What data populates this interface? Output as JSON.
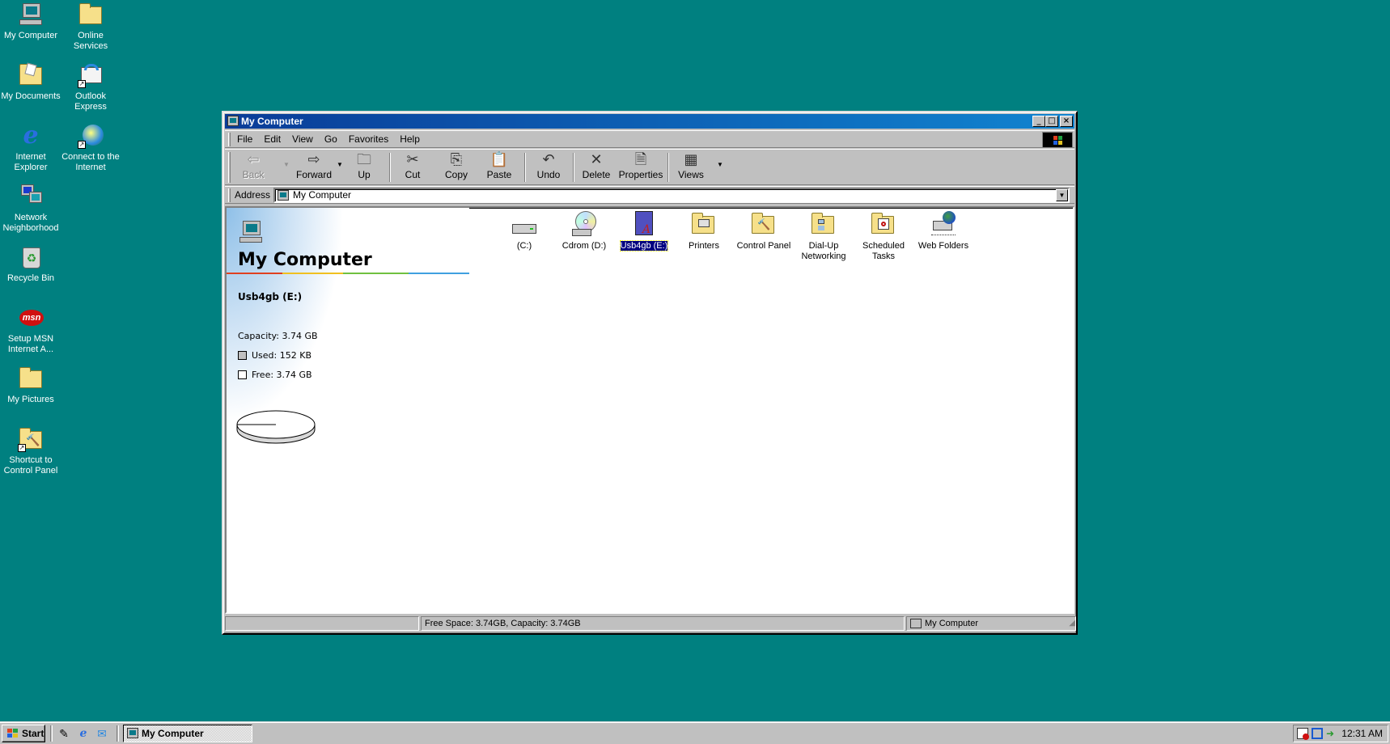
{
  "desktop": {
    "icons": [
      {
        "label": "My Computer",
        "icon": "my-computer-icon"
      },
      {
        "label": "Online Services",
        "icon": "folder-icon"
      },
      {
        "label": "My Documents",
        "icon": "my-documents-icon"
      },
      {
        "label": "Outlook Express",
        "icon": "outlook-express-icon"
      },
      {
        "label": "Internet Explorer",
        "icon": "internet-explorer-icon"
      },
      {
        "label": "Connect to the Internet",
        "icon": "connect-internet-icon"
      },
      {
        "label": "Network Neighborhood",
        "icon": "network-icon"
      },
      {
        "label": "Recycle Bin",
        "icon": "recycle-bin-icon"
      },
      {
        "label": "Setup MSN Internet A...",
        "icon": "msn-icon"
      },
      {
        "label": "My Pictures",
        "icon": "folder-icon"
      },
      {
        "label": "Shortcut to Control Panel",
        "icon": "control-panel-icon"
      }
    ]
  },
  "window": {
    "title": "My Computer",
    "menu": [
      "File",
      "Edit",
      "View",
      "Go",
      "Favorites",
      "Help"
    ],
    "toolbar": {
      "back": "Back",
      "forward": "Forward",
      "up": "Up",
      "cut": "Cut",
      "copy": "Copy",
      "paste": "Paste",
      "undo": "Undo",
      "delete": "Delete",
      "properties": "Properties",
      "views": "Views"
    },
    "address": {
      "label": "Address",
      "value": "My Computer"
    },
    "left_pane": {
      "title": "My Computer",
      "drive_name": "Usb4gb (E:)",
      "capacity": "Capacity: 3.74 GB",
      "used": "Used: 152 KB",
      "free": "Free: 3.74 GB",
      "used_color": "#c0c0c0",
      "free_color": "#ffffff",
      "used_fraction": 4e-05
    },
    "items": [
      {
        "label": "(C:)",
        "icon": "hard-drive-icon",
        "selected": false
      },
      {
        "label": "Cdrom (D:)",
        "icon": "cdrom-icon",
        "selected": false
      },
      {
        "label": "Usb4gb (E:)",
        "icon": "removable-drive-icon",
        "selected": true
      },
      {
        "label": "Printers",
        "icon": "printers-folder-icon",
        "selected": false
      },
      {
        "label": "Control Panel",
        "icon": "control-panel-folder-icon",
        "selected": false
      },
      {
        "label": "Dial-Up Networking",
        "icon": "dialup-folder-icon",
        "selected": false
      },
      {
        "label": "Scheduled Tasks",
        "icon": "scheduled-tasks-folder-icon",
        "selected": false
      },
      {
        "label": "Web Folders",
        "icon": "web-folders-icon",
        "selected": false
      }
    ],
    "status": {
      "info": "Free Space: 3.74GB,  Capacity: 3.74GB",
      "zone": "My Computer"
    }
  },
  "taskbar": {
    "start": "Start",
    "task_button": "My Computer",
    "clock": "12:31 AM"
  },
  "colors": {
    "desktop": "#008080",
    "title_start": "#0a3c98",
    "title_end": "#1084d0",
    "selection": "#000080"
  }
}
